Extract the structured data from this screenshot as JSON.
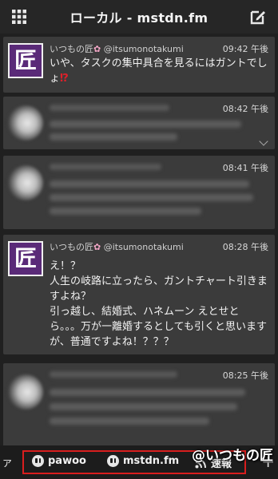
{
  "header": {
    "title": "ローカル - mstdn.fm",
    "menu_icon": "grid-menu-icon",
    "compose_icon": "compose-edit-icon"
  },
  "posts": [
    {
      "display_name": "いつもの匠",
      "handle": "@itsumonotakumi",
      "time": "09:42 午後",
      "avatar_char": "匠",
      "text": "いや、タスクの集中具合を見るにはガントでしょ",
      "emphasis": "⁉"
    },
    {
      "time": "08:42 午後",
      "blurred": true
    },
    {
      "time": "08:41 午後",
      "blurred": true
    },
    {
      "display_name": "いつもの匠",
      "handle": "@itsumonotakumi",
      "time": "08:28 午後",
      "avatar_char": "匠",
      "text": "え！？\n人生の岐路に立ったら、ガントチャート引きますよね？\n引っ越し、結婚式、ハネムーン えとせとら。。。万が一離婚するとしても引くと思いますが、普通ですよね！？？？"
    },
    {
      "time": "08:25 午後",
      "blurred": true
    }
  ],
  "tabs": {
    "left_edge": "ァ",
    "items": [
      {
        "label": "pawoo",
        "icon": "mastodon-icon"
      },
      {
        "label": "mstdn.fm",
        "icon": "mastodon-icon"
      },
      {
        "label": "速報",
        "icon": "rss-icon"
      }
    ],
    "right_edge": "+"
  },
  "watermark": "@いつもの匠",
  "colors": {
    "background": "#202020",
    "card": "#3b3b3b",
    "avatar_bg": "#5a2a78",
    "highlight": "#d81e1e",
    "emphasis": "#e0202a"
  }
}
